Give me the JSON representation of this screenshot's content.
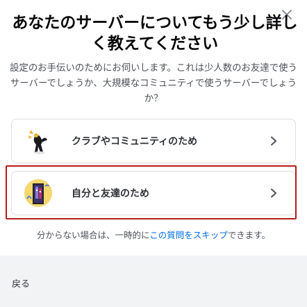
{
  "modal": {
    "title": "あなたのサーバーについてもう少し詳しく教えてください",
    "description": "設定のお手伝いのためにお伺いします。これは少人数のお友達で使うサーバーでしょうか、大規模なコミュニティで使うサーバーでしょうか？",
    "options": [
      {
        "label": "クラブやコミュニティのため",
        "icon": "club-community-icon"
      },
      {
        "label": "自分と友達のため",
        "icon": "friends-door-icon"
      }
    ],
    "skip": {
      "prefix": "分からない場合は、一時的に",
      "link": "この質問をスキップ",
      "suffix": "できます。"
    },
    "back_label": "戻る",
    "close_icon": "close-icon"
  },
  "colors": {
    "link": "#006ce7",
    "selection_outline": "#b71c1c",
    "footer_bg": "#f2f3f5"
  }
}
